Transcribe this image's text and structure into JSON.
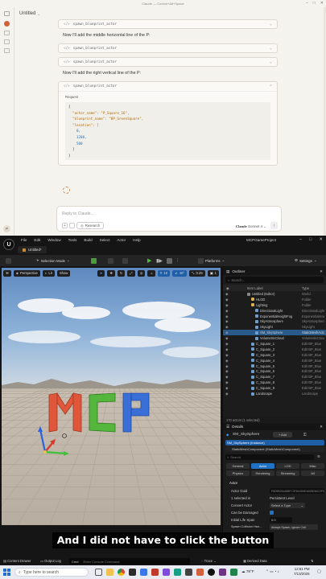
{
  "claude": {
    "window_title": "Claude — Control+Alt+Space",
    "conversation_title": "Untitled",
    "tool_call_1": "spawn_blueprint_actor",
    "message_1": "Now I'll add the middle horizontal line of the P:",
    "tool_call_2": "spawn_blueprint_actor",
    "tool_call_3": "spawn_blueprint_actor",
    "message_2": "Now I'll add the right vertical line of the P:",
    "tool_call_4": "spawn_blueprint_actor",
    "request_label": "Request",
    "request_lines": [
      "{",
      "\"actor_name\": \"P_Square_16\",",
      "\"blueprint_name\": \"BP_GreenSquare\",",
      "\"location\": [",
      "0,",
      "1200,",
      "500",
      "]",
      "}"
    ],
    "reply_placeholder": "Reply to Claude...",
    "research_label": "Research",
    "model_brand": "Claude",
    "model_name": "Sonnet 4",
    "avatar_initial": "P"
  },
  "unreal": {
    "menus": [
      "File",
      "Edit",
      "Window",
      "Tools",
      "Build",
      "Select",
      "Actor",
      "Help"
    ],
    "project_name": "MCPGameProject",
    "tab_label": "Untitled*",
    "mode_label": "Selection Mode",
    "platforms_label": "Platforms",
    "settings_label": "Settings",
    "viewport": {
      "perspective": "Perspective",
      "lit": "Lit",
      "show": "Show",
      "grid_value": "10",
      "angle_value": "10°",
      "scale_value": "0.25",
      "camera_value": "1",
      "letters": "MCP"
    },
    "outliner": {
      "title": "Outliner",
      "search_placeholder": "Search...",
      "col_label": "Item Label",
      "col_type": "Type",
      "rows": [
        {
          "name": "Untitled (Editor)",
          "type": "World",
          "indent": 0
        },
        {
          "name": "HLOD",
          "type": "Folder",
          "indent": 1
        },
        {
          "name": "Lighting",
          "type": "Folder",
          "indent": 1
        },
        {
          "name": "DirectionalLight",
          "type": "DirectionalLight",
          "indent": 2
        },
        {
          "name": "ExponentialHeightFog",
          "type": "ExponentialHeightFog",
          "indent": 2
        },
        {
          "name": "SkyAtmosphere",
          "type": "SkyAtmosphere",
          "indent": 2
        },
        {
          "name": "SkyLight",
          "type": "SkyLight",
          "indent": 2
        },
        {
          "name": "SM_SkySphere",
          "type": "StaticMeshActor",
          "indent": 2,
          "selected": true
        },
        {
          "name": "VolumetricCloud",
          "type": "VolumetricCloud",
          "indent": 2
        },
        {
          "name": "C_Square_1",
          "type": "Edit BP_Blue",
          "indent": 1
        },
        {
          "name": "C_Square_2",
          "type": "Edit BP_Blue",
          "indent": 1
        },
        {
          "name": "C_Square_3",
          "type": "Edit BP_Blue",
          "indent": 1
        },
        {
          "name": "C_Square_4",
          "type": "Edit BP_Blue",
          "indent": 1
        },
        {
          "name": "C_Square_5",
          "type": "Edit BP_Blue",
          "indent": 1
        },
        {
          "name": "C_Square_6",
          "type": "Edit BP_Blue",
          "indent": 1
        },
        {
          "name": "C_Square_7",
          "type": "Edit BP_Blue",
          "indent": 1
        },
        {
          "name": "C_Square_8",
          "type": "Edit BP_Blue",
          "indent": 1
        },
        {
          "name": "C_Square_9",
          "type": "Edit BP_Blue",
          "indent": 1
        },
        {
          "name": "Landscape",
          "type": "Landscape",
          "indent": 1
        }
      ],
      "footer": "170 actors (1 selected)"
    },
    "details": {
      "title": "Details",
      "actor_name": "SM_SkySphere",
      "add_label": "+ Add",
      "instance_label": "SM_SkySphere (Instance)",
      "component_label": "StaticMeshComponent (StaticMeshComponent)",
      "search_placeholder": "Search",
      "filters_row1": [
        "General",
        "Actor",
        "LOD",
        "Misc"
      ],
      "filters_row2": [
        "Physics",
        "Rendering",
        "Streaming",
        "All"
      ],
      "section_actor": "Actor",
      "prop_actor_guid_label": "Actor Guid",
      "prop_actor_guid_value": "F8D9B2B4488FC3F6A49AE4A0BE84C3F5",
      "prop_selected_in_label": "1 selected in",
      "prop_selected_in_value": "Persistent Level",
      "prop_convert_label": "Convert Actor",
      "prop_convert_value": "Select a Type",
      "prop_damaged_label": "Can be Damaged",
      "prop_lifespan_label": "Initial Life Span",
      "prop_lifespan_value": "0.0",
      "prop_spawn_label": "Spawn Collision Han...",
      "prop_spawn_value": "Always Spawn, Ignore Coll"
    },
    "status": {
      "content_drawer": "Content Drawer",
      "output_log": "Output Log",
      "cmd": "Cmd",
      "cmd_placeholder": "Enter Console Command",
      "trace": "Trace",
      "derived_data": "Derived Data"
    }
  },
  "caption": "And I did not have to click the button",
  "taskbar": {
    "search_placeholder": "Type here to search",
    "weather": "78°F",
    "time": "12:51 PM",
    "date": "7/13/2025"
  },
  "colors": {
    "letter_m": "#e0563a",
    "letter_c": "#54b63c",
    "letter_p": "#3a6fd8",
    "selection_blue": "#2a5a8a",
    "accent": "#1f72c6"
  }
}
